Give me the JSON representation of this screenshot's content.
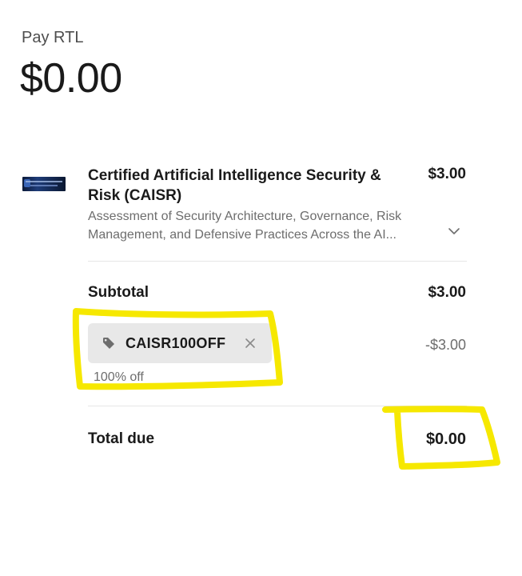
{
  "header": {
    "merchant": "Pay RTL",
    "amount": "$0.00"
  },
  "line_item": {
    "name": "Certified Artificial Intelligence Security & Risk (CAISR)",
    "price": "$3.00",
    "description_line1": "Assessment of Security Architecture, Governance, Risk",
    "description_line2": "Management, and Defensive Practices Across the AI..."
  },
  "summary": {
    "subtotal_label": "Subtotal",
    "subtotal_value": "$3.00",
    "promo_code": "CAISR100OFF",
    "discount_value": "-$3.00",
    "discount_desc": "100% off",
    "total_label": "Total due",
    "total_value": "$0.00"
  },
  "icons": [
    "product-thumbnail",
    "chevron-down-icon",
    "tag-icon",
    "close-icon"
  ],
  "colors": {
    "highlight": "#f6e800",
    "chip_bg": "#e8e8e8",
    "muted_text": "#6d6d6d"
  }
}
